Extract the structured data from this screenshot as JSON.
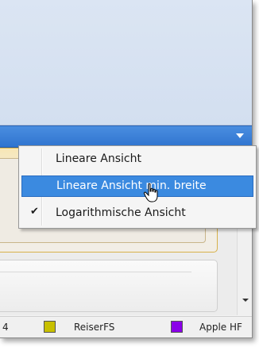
{
  "view_dropdown": {
    "menu": {
      "items": [
        {
          "label": "Lineare Ansicht",
          "state": "normal",
          "checked": false
        },
        {
          "label": "Lineare Ansicht min. breite",
          "state": "highlighted",
          "checked": false
        },
        {
          "label": "Logarithmische Ansicht",
          "state": "normal",
          "checked": true
        }
      ],
      "check_glyph": "✔"
    }
  },
  "legend": {
    "partial_left": "4",
    "items": [
      {
        "label": "ReiserFS",
        "color": "#c8c000"
      },
      {
        "label": "Apple HF",
        "color": "#8a00e8"
      }
    ]
  },
  "colors": {
    "accent": "#3b8ae0",
    "combo_bar": "#2f74cf",
    "panel_border": "#d7b14a"
  }
}
